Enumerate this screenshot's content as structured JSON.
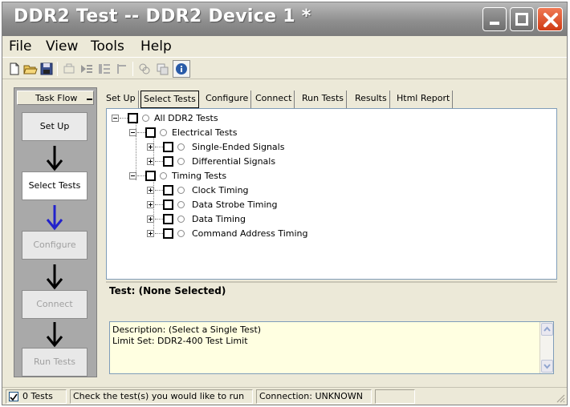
{
  "window": {
    "title": "DDR2 Test -- DDR2 Device 1 *"
  },
  "menu": [
    "File",
    "View",
    "Tools",
    "Help"
  ],
  "toolbar": {
    "icons": [
      "new-file-icon",
      "open-folder-icon",
      "save-icon",
      "cut-icon",
      "run-icon",
      "config-icon",
      "step-icon",
      "copy-icon",
      "paste-icon",
      "info-icon"
    ]
  },
  "taskflow": {
    "title": "Task Flow",
    "steps": [
      {
        "label": "Set Up",
        "state": "normal"
      },
      {
        "label": "Select Tests",
        "state": "active"
      },
      {
        "label": "Configure",
        "state": "disabled"
      },
      {
        "label": "Connect",
        "state": "disabled"
      },
      {
        "label": "Run Tests",
        "state": "disabled"
      }
    ],
    "arrow_colors": [
      "#000000",
      "#2222cc",
      "#000000",
      "#000000"
    ]
  },
  "tabs": [
    "Set Up",
    "Select Tests",
    "Configure",
    "Connect",
    "Run Tests",
    "Results",
    "Html Report"
  ],
  "active_tab": "Select Tests",
  "tree": [
    {
      "label": "All DDR2 Tests",
      "checked": false,
      "expanded": true
    },
    {
      "label": "Electrical Tests",
      "checked": false,
      "expanded": true
    },
    {
      "label": "Single-Ended Signals",
      "checked": false,
      "expanded": false
    },
    {
      "label": "Differential Signals",
      "checked": false,
      "expanded": false
    },
    {
      "label": "Timing Tests",
      "checked": false,
      "expanded": true
    },
    {
      "label": "Clock Timing",
      "checked": false,
      "expanded": false
    },
    {
      "label": "Data Strobe Timing",
      "checked": false,
      "expanded": false
    },
    {
      "label": "Data Timing",
      "checked": false,
      "expanded": false
    },
    {
      "label": "Command Address Timing",
      "checked": false,
      "expanded": false
    }
  ],
  "test_info": {
    "title": "Test: (None Selected)",
    "description": "Description: (Select a Single Test)",
    "limit_set": "Limit Set: DDR2-400 Test Limit"
  },
  "status": {
    "tests": "0 Tests",
    "hint": "Check the test(s) you would like to run",
    "connection": "Connection: UNKNOWN"
  }
}
